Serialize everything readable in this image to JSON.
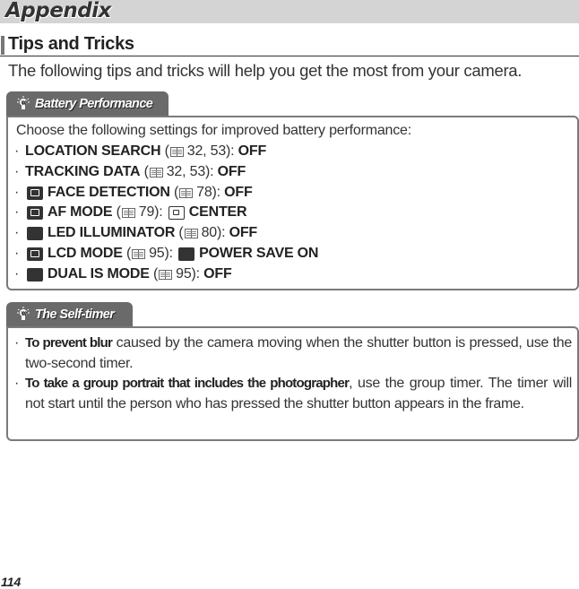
{
  "header": {
    "title": "Appendix"
  },
  "section": {
    "title": "Tips and Tricks",
    "intro": "The following tips and tricks will help you get the most from your camera."
  },
  "battery": {
    "tab_label": "Battery Performance",
    "tab_icon": "lightbulb-icon",
    "lead": "Choose the following settings for improved battery performance:",
    "items": [
      {
        "icon": "",
        "name": "LOCATION SEARCH",
        "ref": "32, 53",
        "value_icon": "",
        "value": "OFF"
      },
      {
        "icon": "",
        "name": "TRACKING DATA",
        "ref": "32, 53",
        "value_icon": "",
        "value": "OFF"
      },
      {
        "icon": "face-detection-icon",
        "name": "FACE DETECTION",
        "ref": "78",
        "value_icon": "",
        "value": "OFF"
      },
      {
        "icon": "af-mode-icon",
        "name": "AF MODE",
        "ref": "79",
        "value_icon": "af-center-icon",
        "value": "CENTER"
      },
      {
        "icon": "led-illuminator-icon",
        "name": "LED ILLUMINATOR",
        "ref": "80",
        "value_icon": "",
        "value": "OFF"
      },
      {
        "icon": "lcd-mode-icon",
        "name": "LCD MODE",
        "ref": "95",
        "value_icon": "power-save-icon",
        "value": "POWER SAVE ON"
      },
      {
        "icon": "dual-is-mode-icon",
        "name": "DUAL IS MODE",
        "ref": "95",
        "value_icon": "",
        "value": "OFF"
      }
    ]
  },
  "selftimer": {
    "tab_label": "The Self-timer",
    "tab_icon": "lightbulb-icon",
    "items": [
      {
        "bold": "To prevent blur",
        "rest": " caused by the camera moving when the shutter button is pressed, use the two-second timer."
      },
      {
        "bold": "To take a group portrait that includes the photographer",
        "rest": ", use the group timer. The timer will not start until the person who has pressed the shutter button appears in the frame."
      }
    ]
  },
  "page_number": "114",
  "colors": {
    "header_bg": "#d4d4d4",
    "tab_bg": "#6a6a6a",
    "box_border": "#7a7a7a"
  }
}
